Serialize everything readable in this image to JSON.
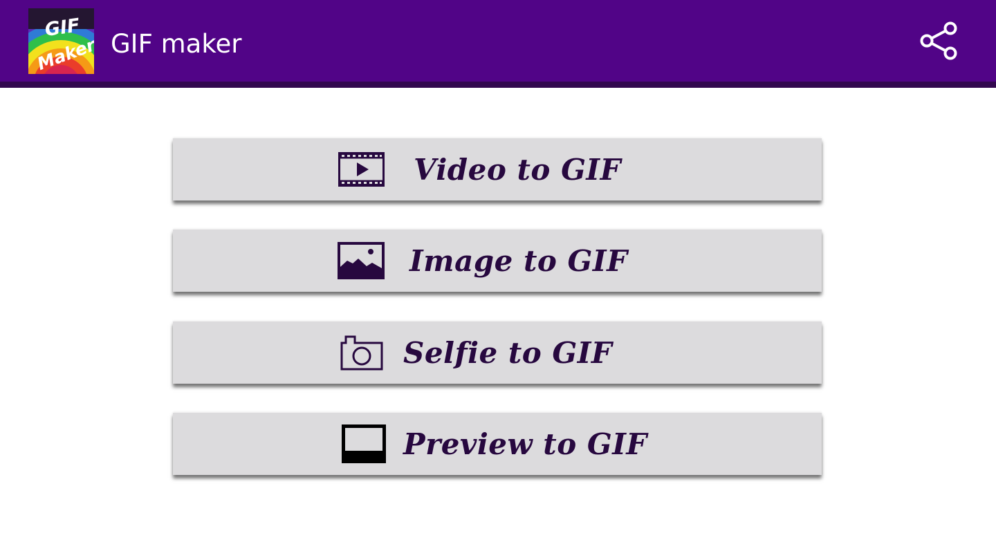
{
  "appbar": {
    "title": "GIF maker",
    "logo": {
      "line1": "GIF",
      "line2": "Maker",
      "icon": "gif-maker-logo"
    },
    "share_icon": "share-icon"
  },
  "menu": [
    {
      "label": "Video to GIF",
      "icon": "video-icon"
    },
    {
      "label": "Image to GIF",
      "icon": "image-icon"
    },
    {
      "label": "Selfie to GIF",
      "icon": "camera-icon"
    },
    {
      "label": "Preview to GIF",
      "icon": "preview-icon"
    }
  ],
  "colors": {
    "appbar": "#510487",
    "appbar_border": "#32084f",
    "button_bg": "#dcdbdd",
    "button_text": "#27083f"
  }
}
